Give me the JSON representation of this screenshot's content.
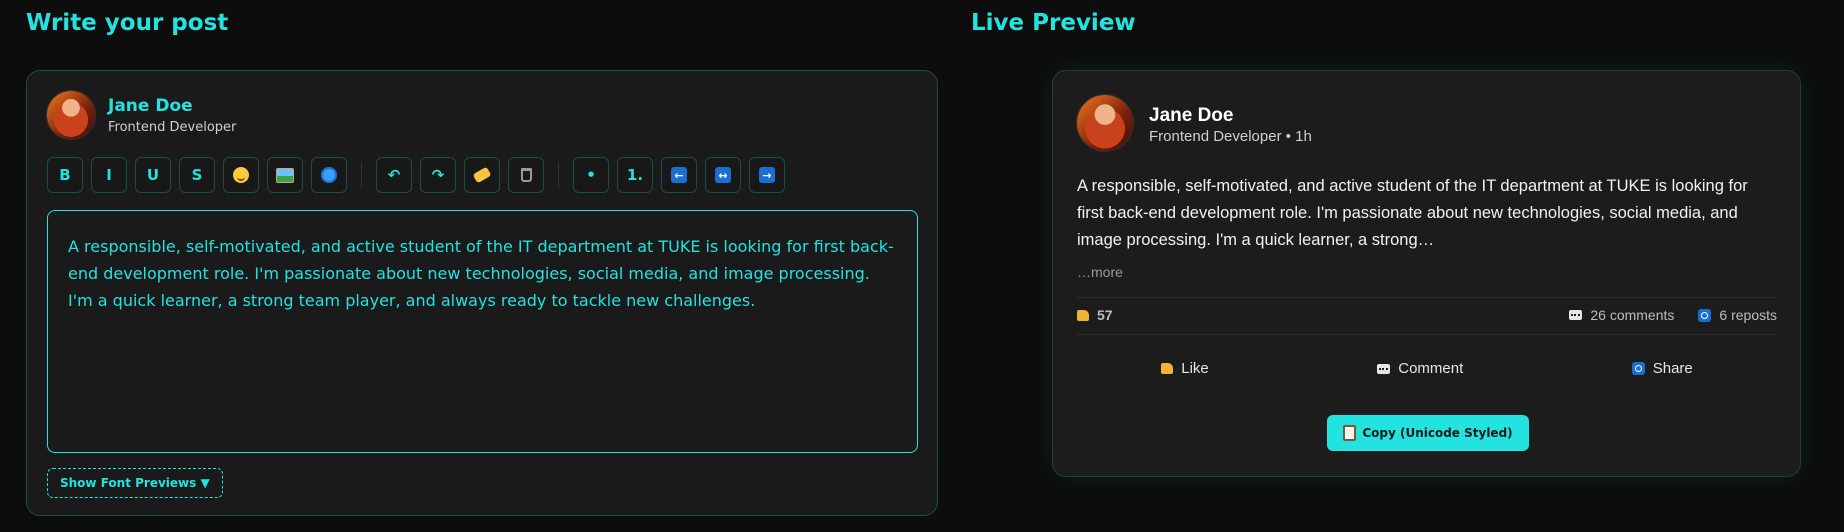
{
  "editor": {
    "section_title": "Write your post",
    "author": {
      "name": "Jane Doe",
      "role": "Frontend Developer"
    },
    "toolbar": {
      "bold": "B",
      "italic": "I",
      "underline": "U",
      "script": "S",
      "ordered_list": "1."
    },
    "content": "A responsible, self-motivated, and active student of the IT department at TUKE is looking for first back-end development role. I'm passionate about new technologies, social media, and image processing. I'm a quick learner, a strong team player, and always ready to tackle new challenges.",
    "font_previews_label": "Show Font Previews ▼"
  },
  "preview": {
    "section_title": "Live Preview",
    "author": {
      "name": "Jane Doe",
      "meta": "Frontend Developer • 1h"
    },
    "post_text": "A responsible, self-motivated, and active student of the IT department at TUKE is looking for first back-end development role. I'm passionate about new technologies, social media, and image processing. I'm a quick learner, a strong…",
    "more_label": "…more",
    "stats": {
      "likes": "57",
      "comments": "26 comments",
      "reposts": "6 reposts"
    },
    "actions": {
      "like": "Like",
      "comment": "Comment",
      "share": "Share"
    },
    "copy_button": "Copy (Unicode Styled)"
  },
  "colors": {
    "accent": "#22e3e0",
    "background": "#0d0d0d",
    "card": "#1a1a1a"
  }
}
